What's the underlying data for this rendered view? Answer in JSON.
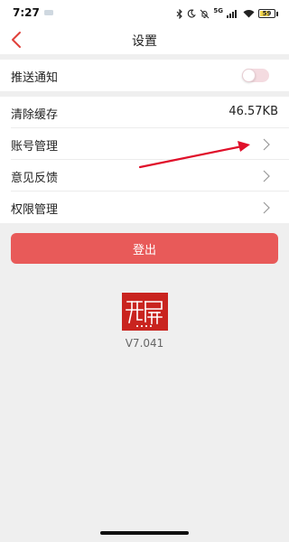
{
  "status_bar": {
    "time": "7:27",
    "network": "5G",
    "battery": "59",
    "battery_level": 0.59
  },
  "header": {
    "title": "设置"
  },
  "settings": {
    "push": {
      "label": "推送通知",
      "enabled": false
    },
    "cache": {
      "label": "清除缓存",
      "value": "46.57KB"
    },
    "account": {
      "label": "账号管理"
    },
    "feedback": {
      "label": "意见反馈"
    },
    "permissions": {
      "label": "权限管理"
    }
  },
  "logout_label": "登出",
  "about": {
    "version": "V7.041"
  },
  "colors": {
    "accent": "#e85a59",
    "back_arrow": "#e0403a",
    "logo": "#c9241f",
    "annotation": "#e0102a"
  }
}
